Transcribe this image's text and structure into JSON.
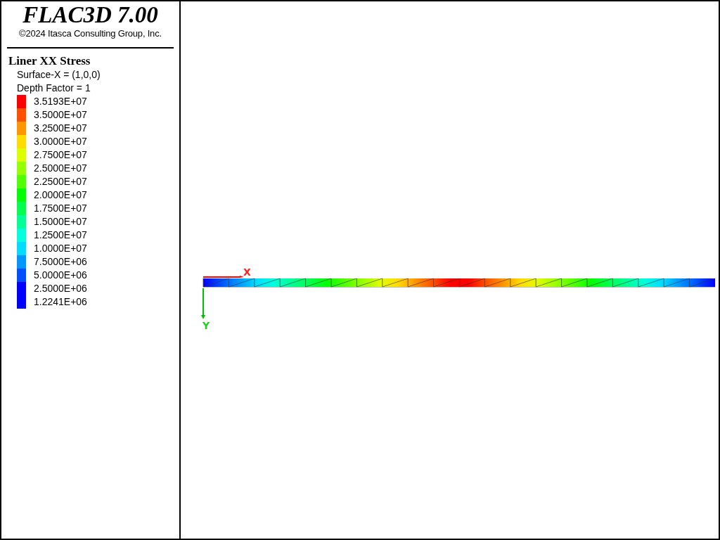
{
  "title": "FLAC3D 7.00",
  "copyright": "©2024 Itasca Consulting Group, Inc.",
  "legend": {
    "title": "Liner XX Stress",
    "lines": [
      "Surface-X = (1,0,0)",
      "Depth Factor = 1"
    ],
    "items": [
      {
        "label": "3.5193E+07",
        "color": "#ff0000"
      },
      {
        "label": "3.5000E+07",
        "color": "#ff5000"
      },
      {
        "label": "3.2500E+07",
        "color": "#ff9600"
      },
      {
        "label": "3.0000E+07",
        "color": "#ffdc00"
      },
      {
        "label": "2.7500E+07",
        "color": "#dcff00"
      },
      {
        "label": "2.5000E+07",
        "color": "#96ff00"
      },
      {
        "label": "2.2500E+07",
        "color": "#50ff00"
      },
      {
        "label": "2.0000E+07",
        "color": "#00ff00"
      },
      {
        "label": "1.7500E+07",
        "color": "#00ff50"
      },
      {
        "label": "1.5000E+07",
        "color": "#00ff96"
      },
      {
        "label": "1.2500E+07",
        "color": "#00ffdc"
      },
      {
        "label": "1.0000E+07",
        "color": "#00dcff"
      },
      {
        "label": "7.5000E+06",
        "color": "#0096ff"
      },
      {
        "label": "5.0000E+06",
        "color": "#0050ff"
      },
      {
        "label": "2.5000E+06",
        "color": "#0000ff"
      },
      {
        "label": "1.2241E+06",
        "color": "#0000ff"
      }
    ]
  },
  "axes": {
    "x_label": "X",
    "y_label": "Y"
  }
}
